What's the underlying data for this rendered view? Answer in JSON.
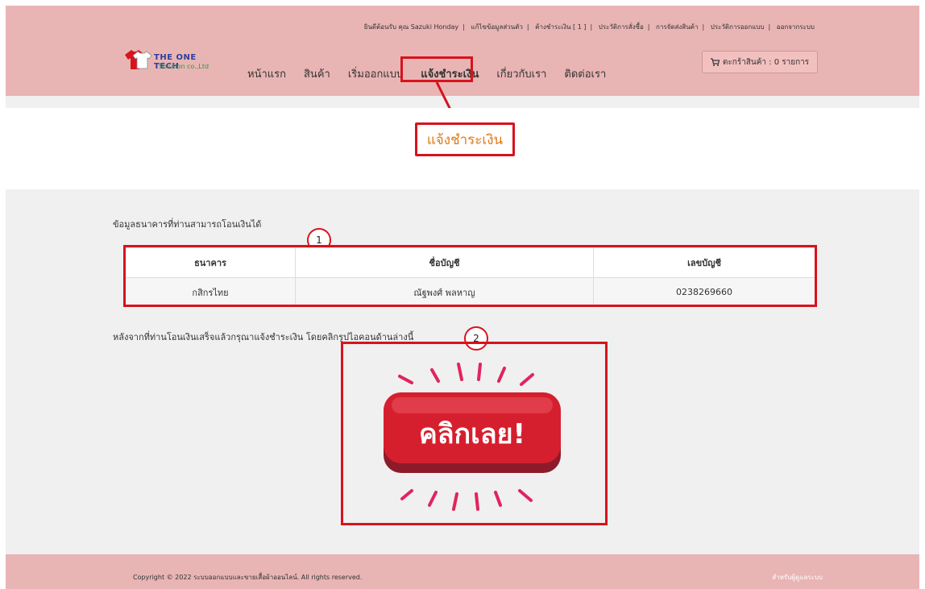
{
  "topbar": {
    "links": [
      "ยินดีต้อนรับ คุณ Sazuki Honday",
      "แก้ไขข้อมูลส่วนตัว",
      "ค้างชำระเงิน [ 1 ]",
      "ประวัติการสั่งซื้อ",
      "การจัดส่งสินค้า",
      "ประวัติการออกแบบ",
      "ออกจากระบบ"
    ]
  },
  "logo": {
    "brand": "THE ONE TECH",
    "sub": "Solution co.,Ltd"
  },
  "menu": [
    "หน้าแรก",
    "สินค้า",
    "เริ่มออกแบบ",
    "แจ้งชำระเงิน",
    "เกี่ยวกับเรา",
    "ติดต่อเรา"
  ],
  "cart": {
    "label": "ตะกร้าสินค้า : 0 รายการ"
  },
  "page_title": "แจ้งชำระเงิน",
  "bank_section": {
    "intro": "ข้อมูลธนาคารที่ท่านสามารถโอนเงินได้",
    "headers": [
      "ธนาคาร",
      "ชื่อบัญชี",
      "เลขบัญชี"
    ],
    "rows": [
      [
        "กสิกรไทย",
        "ณัฐพงศ์ พลหาญ",
        "0238269660"
      ]
    ]
  },
  "badges": {
    "one": "1",
    "two": "2"
  },
  "note": "หลังจากที่ท่านโอนเงินเสร็จแล้วกรุณาแจ้งชำระเงิน โดยคลิกรูปไอคอนด้านล่างนี้",
  "click_button": {
    "label": "คลิกเลย!"
  },
  "footer": {
    "copyright": "Copyright © 2022 ระบบออกแบบและขายเสื้อผ้าออนไลน์. All rights reserved.",
    "admin": "สำหรับผู้ดูแลระบบ"
  },
  "colors": {
    "pink": "#e9b4b4",
    "highlight_red": "#d7131d",
    "title_orange": "#e07a1a",
    "button_red": "#d61f2e"
  }
}
